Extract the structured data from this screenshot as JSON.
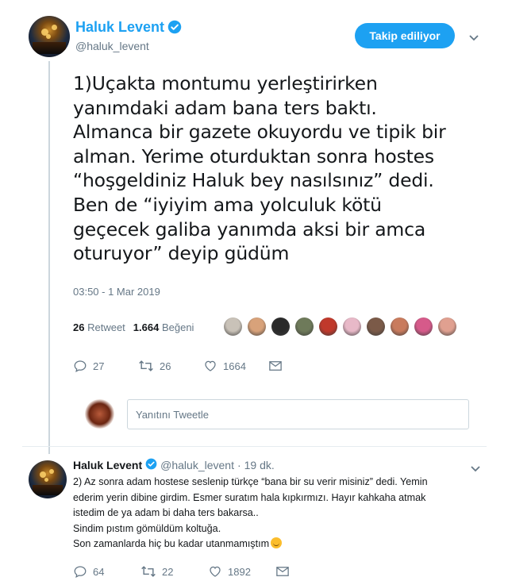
{
  "main_tweet": {
    "author_name": "Haluk Levent",
    "author_handle": "@haluk_levent",
    "follow_button_label": "Takip ediliyor",
    "text": "1)Uçakta montumu yerleştirirken\nyanımdaki adam bana ters baktı.\nAlmanca bir gazete okuyordu ve tipik bir\nalman. Yerime oturduktan sonra hostes\n“hoşgeldiniz Haluk bey nasılsınız” dedi.\nBen de “iyiyim ama yolculuk kötü\ngeçecek galiba yanımda aksi bir amca\noturuyor” deyip güdüm",
    "timestamp": "03:50 - 1 Mar 2019",
    "retweet_count": "26",
    "retweet_label": "Retweet",
    "like_count": "1.664",
    "like_label": "Beğeni",
    "actions": {
      "replies": "27",
      "retweets": "26",
      "likes": "1664"
    }
  },
  "reply_input": {
    "placeholder": "Yanıtını Tweetle"
  },
  "reply_tweet": {
    "author_name": "Haluk Levent",
    "author_handle": "@haluk_levent",
    "separator": "·",
    "time_ago": "19 dk.",
    "lines": [
      "2) Az sonra adam hostese seslenip türkçe “bana bir su verir misiniz” dedi. Yemin",
      "ederim yerin dibine girdim. Esmer suratım hala kıpkırmızı. Hayır kahkaha atmak",
      "istedim de ya adam bi daha ters bakarsa..",
      "Sindim pıstım gömüldüm koltuğa.",
      "Son zamanlarda hiç bu kadar utanmamıştım"
    ],
    "actions": {
      "replies": "64",
      "retweets": "22",
      "likes": "1892"
    }
  },
  "colors": {
    "brand": "#1da1f2",
    "muted": "#657786",
    "border": "#ccd6dd"
  },
  "liker_avatars": [
    "#c9c2b8",
    "#d8a27a",
    "#2a2a2a",
    "#6e7a5a",
    "#c0392b",
    "#e8b9c8",
    "#7b5a48",
    "#c97b5d",
    "#d65a8a",
    "#e0a090"
  ]
}
